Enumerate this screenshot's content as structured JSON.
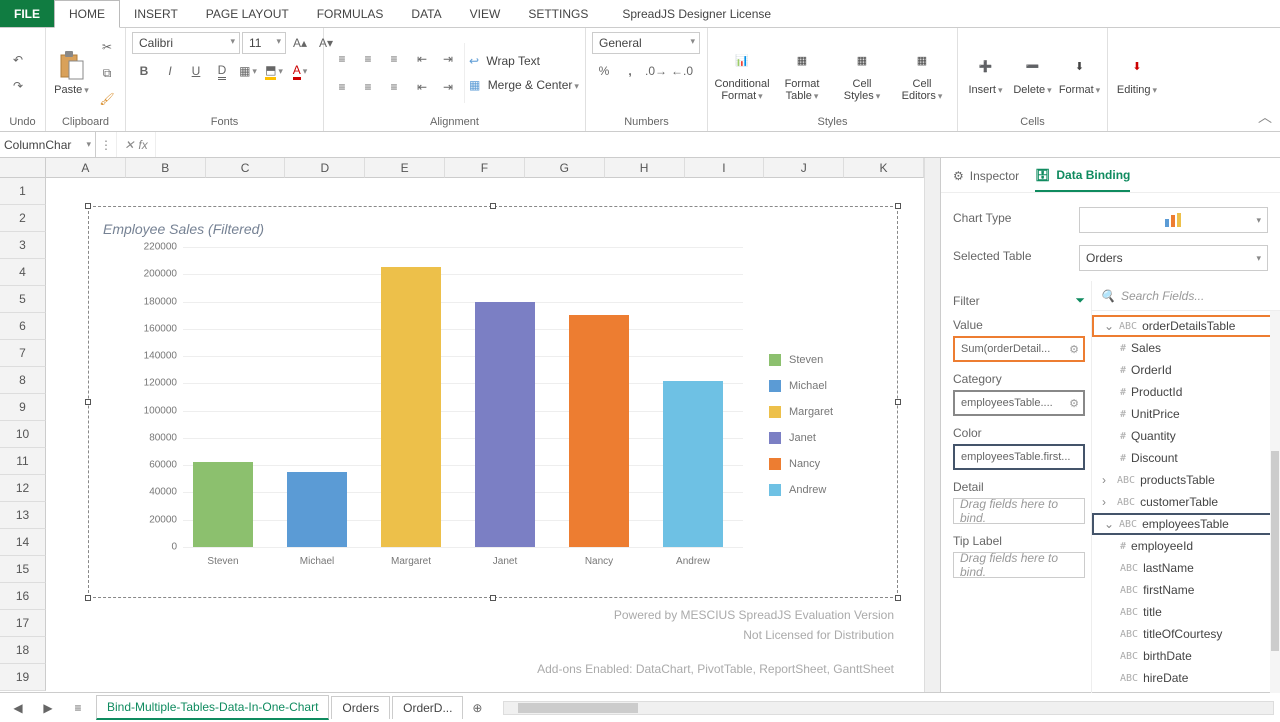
{
  "menu": {
    "file": "FILE",
    "tabs": [
      "HOME",
      "INSERT",
      "PAGE LAYOUT",
      "FORMULAS",
      "DATA",
      "VIEW",
      "SETTINGS"
    ],
    "license": "SpreadJS Designer License"
  },
  "ribbon": {
    "undo": "Undo",
    "clipboard": {
      "paste": "Paste",
      "label": "Clipboard"
    },
    "fonts": {
      "family": "Calibri",
      "size": "11",
      "label": "Fonts"
    },
    "alignment": {
      "wrap": "Wrap Text",
      "merge": "Merge & Center",
      "label": "Alignment"
    },
    "numbers": {
      "format": "General",
      "label": "Numbers"
    },
    "styles": {
      "cond": "Conditional Format",
      "fmttbl": "Format Table",
      "cellstyles": "Cell Styles",
      "celled": "Cell Editors",
      "label": "Styles"
    },
    "cells": {
      "insert": "Insert",
      "delete": "Delete",
      "format": "Format",
      "label": "Cells"
    },
    "editing": {
      "editing": "Editing"
    }
  },
  "namebox": "ColumnChar",
  "columns": [
    "A",
    "B",
    "C",
    "D",
    "E",
    "F",
    "G",
    "H",
    "I",
    "J",
    "K"
  ],
  "rows_count": 19,
  "chart_data": {
    "type": "bar",
    "title": "Employee Sales (Filtered)",
    "categories": [
      "Steven",
      "Michael",
      "Margaret",
      "Janet",
      "Nancy",
      "Andrew"
    ],
    "values": [
      62000,
      55000,
      205000,
      180000,
      170000,
      122000
    ],
    "ylim": [
      0,
      220000
    ],
    "yticks": [
      0,
      20000,
      40000,
      60000,
      80000,
      100000,
      120000,
      140000,
      160000,
      180000,
      200000,
      220000
    ],
    "colors": [
      "#8cc06e",
      "#5b9bd5",
      "#edc04a",
      "#7b7fc4",
      "#ed7d31",
      "#6ec1e4"
    ],
    "legend": [
      "Steven",
      "Michael",
      "Margaret",
      "Janet",
      "Nancy",
      "Andrew"
    ],
    "xlabel": "",
    "ylabel": ""
  },
  "watermarks": {
    "w1": "Powered by MESCIUS SpreadJS Evaluation Version",
    "w2": "Not Licensed for Distribution",
    "w3": "Add-ons Enabled: DataChart, PivotTable, ReportSheet, GanttSheet"
  },
  "panel": {
    "tab_inspector": "Inspector",
    "tab_databinding": "Data Binding",
    "chartType": "Chart Type",
    "selectedTable": "Selected Table",
    "selectedTableVal": "Orders",
    "filter": "Filter",
    "value": "Value",
    "valueChip": "Sum(orderDetail...",
    "category": "Category",
    "categoryChip": "employeesTable....",
    "color": "Color",
    "colorChip": "employeesTable.first...",
    "detail": "Detail",
    "tip": "Tip Label",
    "dragHint": "Drag fields here to bind.",
    "searchPlaceholder": "Search Fields...",
    "tree": [
      {
        "exp": "v",
        "t": "ABC",
        "l": "orderDetailsTable",
        "sel": "orange"
      },
      {
        "child": true,
        "t": "#",
        "l": "Sales"
      },
      {
        "child": true,
        "t": "#",
        "l": "OrderId"
      },
      {
        "child": true,
        "t": "#",
        "l": "ProductId"
      },
      {
        "child": true,
        "t": "#",
        "l": "UnitPrice"
      },
      {
        "child": true,
        "t": "#",
        "l": "Quantity"
      },
      {
        "child": true,
        "t": "#",
        "l": "Discount"
      },
      {
        "exp": ">",
        "t": "ABC",
        "l": "productsTable"
      },
      {
        "exp": ">",
        "t": "ABC",
        "l": "customerTable"
      },
      {
        "exp": "v",
        "t": "ABC",
        "l": "employeesTable",
        "sel": "navy"
      },
      {
        "child": true,
        "t": "#",
        "l": "employeeId"
      },
      {
        "child": true,
        "t": "ABC",
        "l": "lastName"
      },
      {
        "child": true,
        "t": "ABC",
        "l": "firstName"
      },
      {
        "child": true,
        "t": "ABC",
        "l": "title"
      },
      {
        "child": true,
        "t": "ABC",
        "l": "titleOfCourtesy"
      },
      {
        "child": true,
        "t": "ABC",
        "l": "birthDate"
      },
      {
        "child": true,
        "t": "ABC",
        "l": "hireDate"
      }
    ]
  },
  "sheets": {
    "active": "Bind-Multiple-Tables-Data-In-One-Chart",
    "others": [
      "Orders",
      "OrderD..."
    ]
  }
}
